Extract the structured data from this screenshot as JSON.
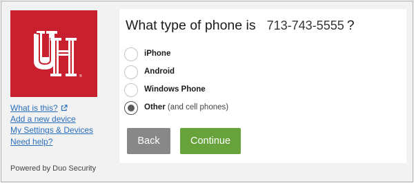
{
  "colors": {
    "brand": "#c8202f",
    "back_button": "#888888",
    "continue_button": "#67a33a",
    "link": "#2a6ebb"
  },
  "sidebar": {
    "logo_icon": "university-of-houston-logo",
    "links": {
      "what_is_this": "What is this?",
      "what_is_this_icon": "external-link-icon",
      "add_device": "Add a new device",
      "settings": "My Settings & Devices",
      "help": "Need help?"
    },
    "powered_by": "Powered by Duo Security"
  },
  "main": {
    "question_prefix": "What type of phone is",
    "phone_number": "713-743-5555",
    "question_suffix": "?",
    "options": [
      {
        "label": "iPhone",
        "sublabel": "",
        "checked": false
      },
      {
        "label": "Android",
        "sublabel": "",
        "checked": false
      },
      {
        "label": "Windows Phone",
        "sublabel": "",
        "checked": false
      },
      {
        "label": "Other",
        "sublabel": "(and cell phones)",
        "checked": true
      }
    ],
    "buttons": {
      "back": "Back",
      "continue": "Continue"
    }
  }
}
